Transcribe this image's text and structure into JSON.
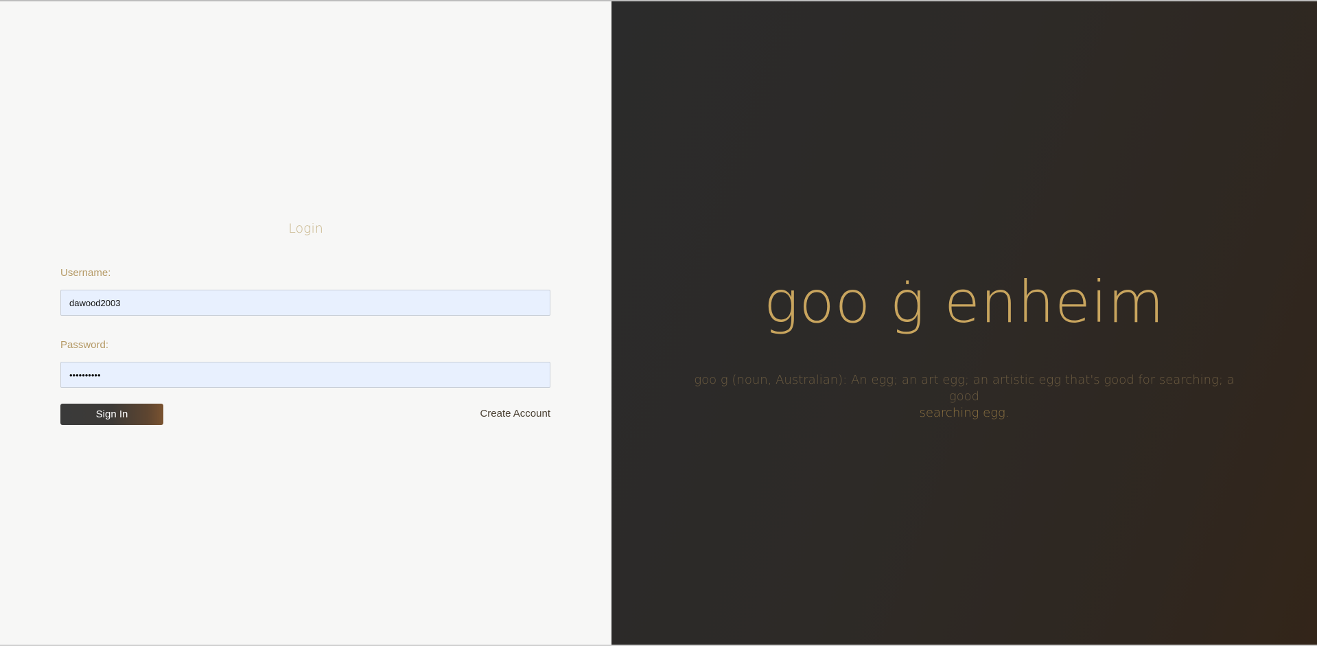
{
  "login": {
    "title": "Login",
    "username_label": "Username:",
    "username_value": "dawood2003",
    "password_label": "Password:",
    "password_value": "••••••••••",
    "signin_label": "Sign In",
    "create_account_label": "Create Account"
  },
  "brand": {
    "title": "goo ġ enheim",
    "definition_main": "goo g (noun, Australian): An egg; an art egg; an artistic egg that's good for searching; a good",
    "definition_tail": "searching egg."
  },
  "colors": {
    "left_background": "#f7f7f6",
    "right_background": "#2d2a27",
    "gold_accent": "#c9a55e",
    "label_tan": "#b59a66",
    "input_fill": "#e8f0fe"
  }
}
